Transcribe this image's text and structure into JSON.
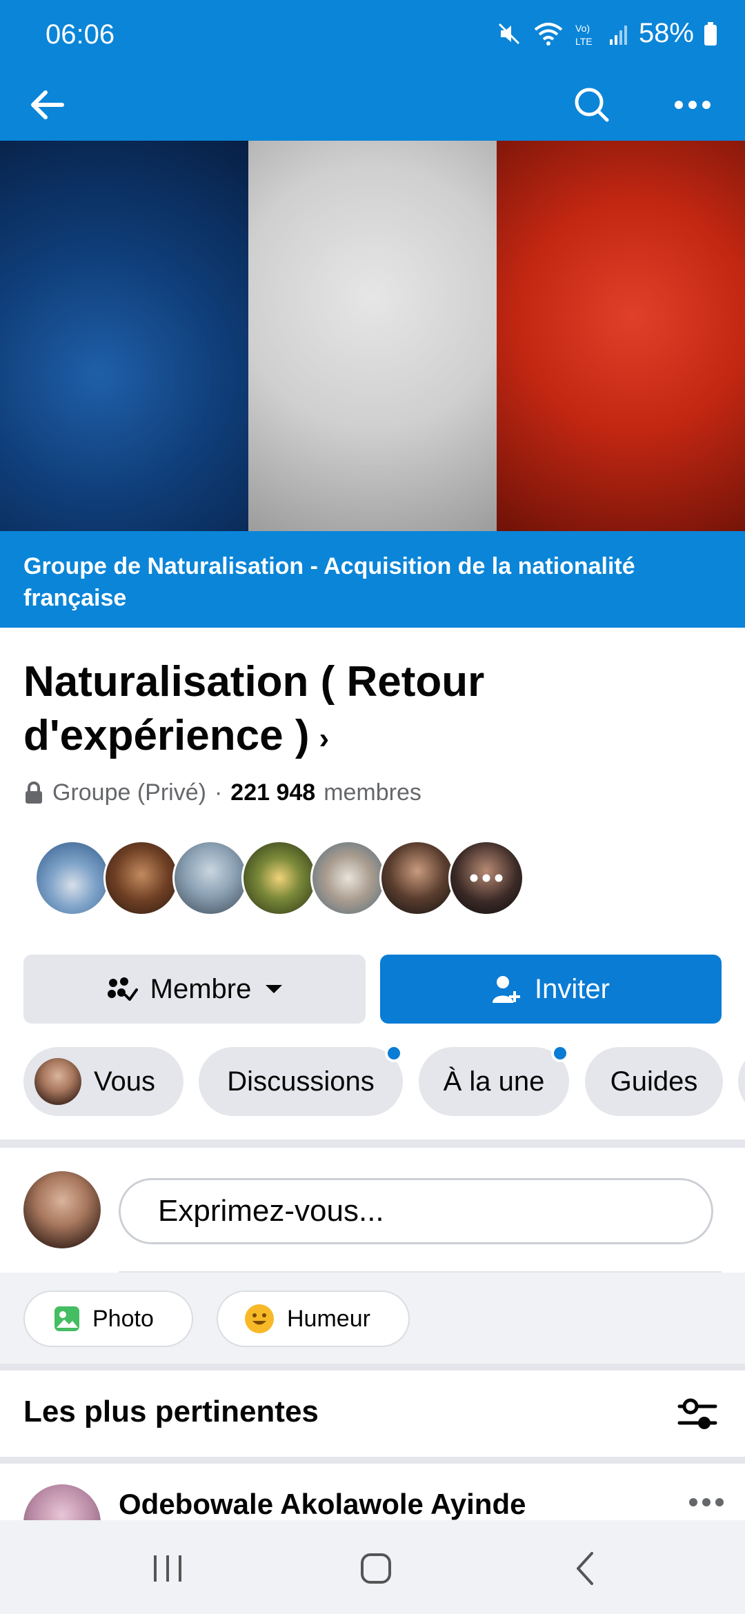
{
  "status_bar": {
    "time": "06:06",
    "battery": "58%"
  },
  "top_bar": {
    "back_icon": "arrow-left-icon",
    "search_icon": "search-icon",
    "more_icon": "more-horizontal-icon"
  },
  "group": {
    "banner_text": "Groupe de Naturalisation - Acquisition de la nationalité française",
    "title": "Naturalisation ( Retour d'expérience )",
    "privacy": "Groupe (Privé)",
    "separator": "·",
    "member_count": "221 948",
    "members_label": "membres"
  },
  "actions": {
    "member_label": "Membre",
    "invite_label": "Inviter"
  },
  "tabs": [
    {
      "label": "Vous"
    },
    {
      "label": "Discussions"
    },
    {
      "label": "À la une"
    },
    {
      "label": "Guides"
    }
  ],
  "composer": {
    "placeholder": "Exprimez-vous..."
  },
  "chips": {
    "photo_label": "Photo",
    "mood_label": "Humeur"
  },
  "feed": {
    "sort_title": "Les plus pertinentes",
    "first_post_author": "Odebowale Akolawole Ayinde"
  },
  "colors": {
    "facebook_blue": "#0a85d8",
    "button_blue": "#0a7cd4",
    "button_gray": "#e4e6eb"
  }
}
